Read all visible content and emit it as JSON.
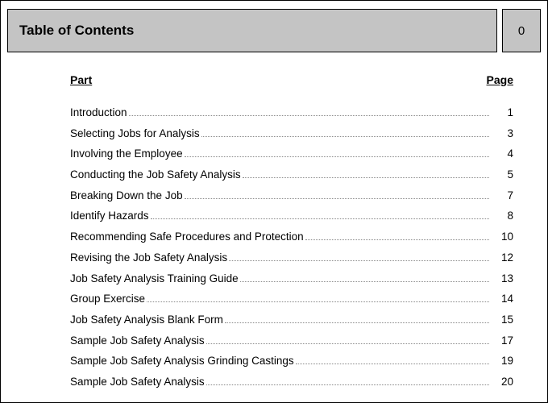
{
  "header": {
    "title": "Table of Contents",
    "page_number": "0"
  },
  "columns": {
    "part": "Part",
    "page": "Page"
  },
  "toc": [
    {
      "title": "Introduction",
      "page": "1"
    },
    {
      "title": "Selecting Jobs for Analysis",
      "page": "3"
    },
    {
      "title": "Involving the Employee",
      "page": "4"
    },
    {
      "title": "Conducting the Job Safety Analysis",
      "page": "5"
    },
    {
      "title": "Breaking Down the Job",
      "page": "7"
    },
    {
      "title": "Identify Hazards",
      "page": "8"
    },
    {
      "title": "Recommending Safe Procedures and Protection",
      "page": "10"
    },
    {
      "title": "Revising the Job Safety Analysis",
      "page": "12"
    },
    {
      "title": "Job Safety Analysis Training Guide",
      "page": "13"
    },
    {
      "title": "Group Exercise",
      "page": "14"
    },
    {
      "title": "Job Safety Analysis Blank Form",
      "page": "15"
    },
    {
      "title": "Sample Job Safety Analysis",
      "page": "17"
    },
    {
      "title": "Sample Job Safety Analysis Grinding Castings",
      "page": "19"
    },
    {
      "title": "Sample Job Safety Analysis",
      "page": "20"
    }
  ]
}
